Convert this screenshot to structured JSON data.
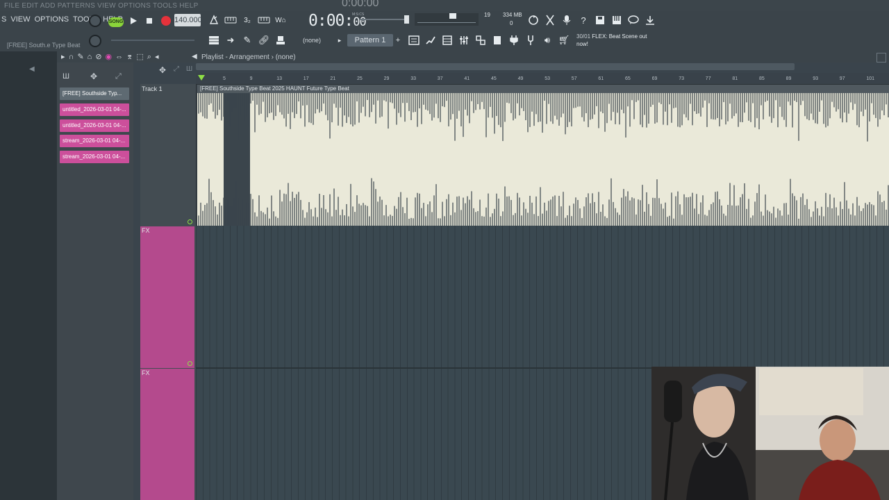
{
  "ghost": {
    "menu": "FILE EDIT ADD PATTERNS VIEW OPTIONS TOOLS HELP",
    "time": "0:00:00"
  },
  "menu": {
    "items": [
      "S",
      "VIEW",
      "OPTIONS",
      "TOOLS",
      "HELP"
    ]
  },
  "transport": {
    "song_label": "SONG",
    "tempo": "140.000",
    "time_main": "0:00:",
    "time_sub": "00",
    "time_caption": "M:S:CS"
  },
  "monitor": {
    "cpu": "19",
    "memory": "334 MB",
    "polyphony": "0"
  },
  "toolbar2": {
    "hint_title": "[FREE] South.e Type Beat",
    "pattern_none": "(none)",
    "pattern_selected": "Pattern 1",
    "news_date": "30/01",
    "news_text": "FLEX: Beat Scene out now!"
  },
  "playlist": {
    "title": "Playlist - Arrangement › (none)",
    "track1": "Track 1",
    "fx_label": "FX",
    "audio_clip_title": "[FREE] Southside Type Beat 2025 HAUNT Future Type Beat",
    "ruler_ticks": [
      "5",
      "9",
      "13",
      "17",
      "21",
      "25",
      "29",
      "33",
      "37",
      "41",
      "45",
      "49",
      "53",
      "57",
      "61",
      "65",
      "69",
      "73",
      "77",
      "81",
      "85",
      "89",
      "93",
      "97",
      "101"
    ],
    "clips": [
      "[FREE] Southside Typ...",
      "untitled_2026-03-01 04-...",
      "untitled_2026-03-01 04-...",
      "stream_2026-03-01 04-...",
      "stream_2026-03-01 04-..."
    ]
  },
  "colors": {
    "clip_pink": "#cc4f9b",
    "fx_pink": "#b44a8d",
    "song_green": "#8bd43a",
    "record_red": "#e5323b",
    "waveform_bg": "#eae9d9",
    "waveform_dark": "#3b454c"
  }
}
